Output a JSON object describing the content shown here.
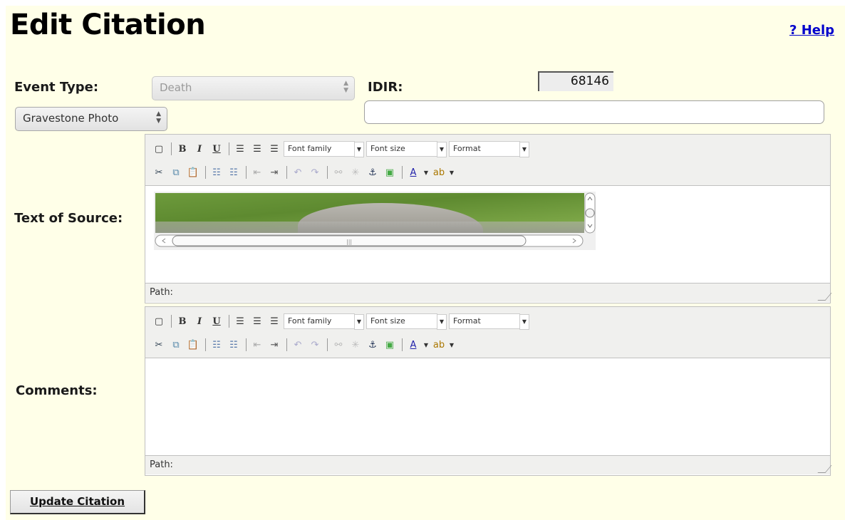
{
  "title": "Edit Citation",
  "help_link": "? Help",
  "event_type": {
    "label": "Event Type:",
    "value": "Death"
  },
  "idir": {
    "label": "IDIR:",
    "value": "68146"
  },
  "source_type": {
    "value": "Gravestone Photo"
  },
  "detail_input": {
    "value": ""
  },
  "text_of_source": {
    "label": "Text of Source:",
    "path_label": "Path:",
    "image": "gravestone-photo"
  },
  "comments": {
    "label": "Comments:",
    "path_label": "Path:"
  },
  "toolbar": {
    "font_family": "Font family",
    "font_size": "Font size",
    "format": "Format",
    "row1_icons": [
      "new-document-icon",
      "bold-icon",
      "italic-icon",
      "underline-icon",
      "align-left-icon",
      "align-center-icon",
      "align-right-icon"
    ],
    "row2_icons": [
      "cut-icon",
      "copy-icon",
      "paste-icon",
      "bullet-list-icon",
      "numbered-list-icon",
      "outdent-icon",
      "indent-icon",
      "undo-icon",
      "redo-icon",
      "link-icon",
      "unlink-icon",
      "anchor-icon",
      "image-icon",
      "text-color-icon",
      "highlight-color-icon"
    ]
  },
  "update_button": "Update Citation",
  "colors": {
    "page_bg": "#ffffe8",
    "link": "#0000cc",
    "toolbar_bg": "#f0f0ee"
  }
}
